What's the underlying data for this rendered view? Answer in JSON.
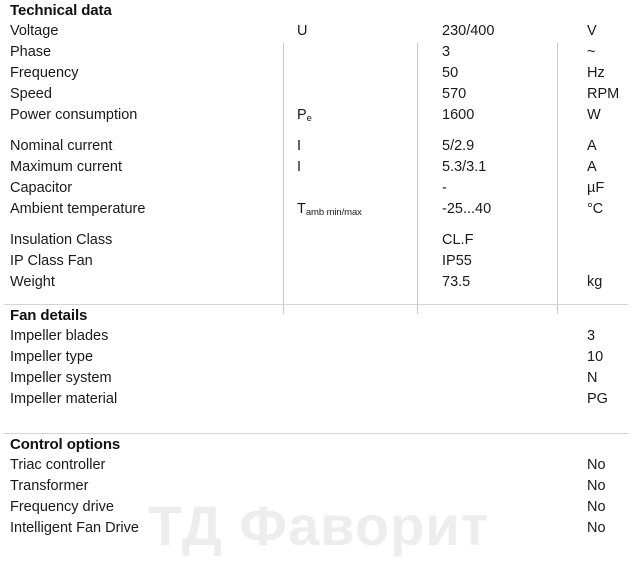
{
  "watermark": {
    "text": "ТД Фаворит",
    "color": "#ededed"
  },
  "sections": [
    {
      "id": "technical",
      "title": "Technical data",
      "rows": [
        {
          "label": "Voltage",
          "symbol": "U",
          "symbol_sub": "",
          "value": "230/400",
          "unit": "V",
          "gap": false
        },
        {
          "label": "Phase",
          "symbol": "",
          "symbol_sub": "",
          "value": "3",
          "unit": "~",
          "gap": false
        },
        {
          "label": "Frequency",
          "symbol": "",
          "symbol_sub": "",
          "value": "50",
          "unit": "Hz",
          "gap": false
        },
        {
          "label": "Speed",
          "symbol": "",
          "symbol_sub": "",
          "value": "570",
          "unit": "RPM",
          "gap": false
        },
        {
          "label": "Power consumption",
          "symbol": "P",
          "symbol_sub": "e",
          "value": "1600",
          "unit": "W",
          "gap": false
        },
        {
          "label": "Nominal current",
          "symbol": "I",
          "symbol_sub": "",
          "value": "5/2.9",
          "unit": "A",
          "gap": true
        },
        {
          "label": "Maximum current",
          "symbol": "I",
          "symbol_sub": "",
          "value": "5.3/3.1",
          "unit": "A",
          "gap": false
        },
        {
          "label": "Capacitor",
          "symbol": "",
          "symbol_sub": "",
          "value": "-",
          "unit": "µF",
          "gap": false
        },
        {
          "label": "Ambient temperature",
          "symbol": "T",
          "symbol_sub": "amb min/max",
          "value": "-25...40",
          "unit": "°C",
          "gap": false
        },
        {
          "label": "Insulation Class",
          "symbol": "",
          "symbol_sub": "",
          "value": "CL.F",
          "unit": "",
          "gap": true
        },
        {
          "label": "IP Class Fan",
          "symbol": "",
          "symbol_sub": "",
          "value": "IP55",
          "unit": "",
          "gap": false
        },
        {
          "label": "Weight",
          "symbol": "",
          "symbol_sub": "",
          "value": "73.5",
          "unit": "kg",
          "gap": false
        }
      ]
    },
    {
      "id": "fan",
      "title": "Fan details",
      "rows": [
        {
          "label": "Impeller blades",
          "value": "3",
          "gap": false
        },
        {
          "label": "Impeller type",
          "value": "10",
          "gap": false
        },
        {
          "label": "Impeller system",
          "value": "N",
          "gap": false
        },
        {
          "label": "Impeller material",
          "value": "PG",
          "gap": false
        }
      ]
    },
    {
      "id": "control",
      "title": "Control options",
      "rows": [
        {
          "label": "Triac controller",
          "value": "No",
          "gap": false
        },
        {
          "label": "Transformer",
          "value": "No",
          "gap": false
        },
        {
          "label": "Frequency drive",
          "value": "No",
          "gap": false
        },
        {
          "label": "Intelligent Fan Drive",
          "value": "No",
          "gap": false
        }
      ]
    }
  ]
}
